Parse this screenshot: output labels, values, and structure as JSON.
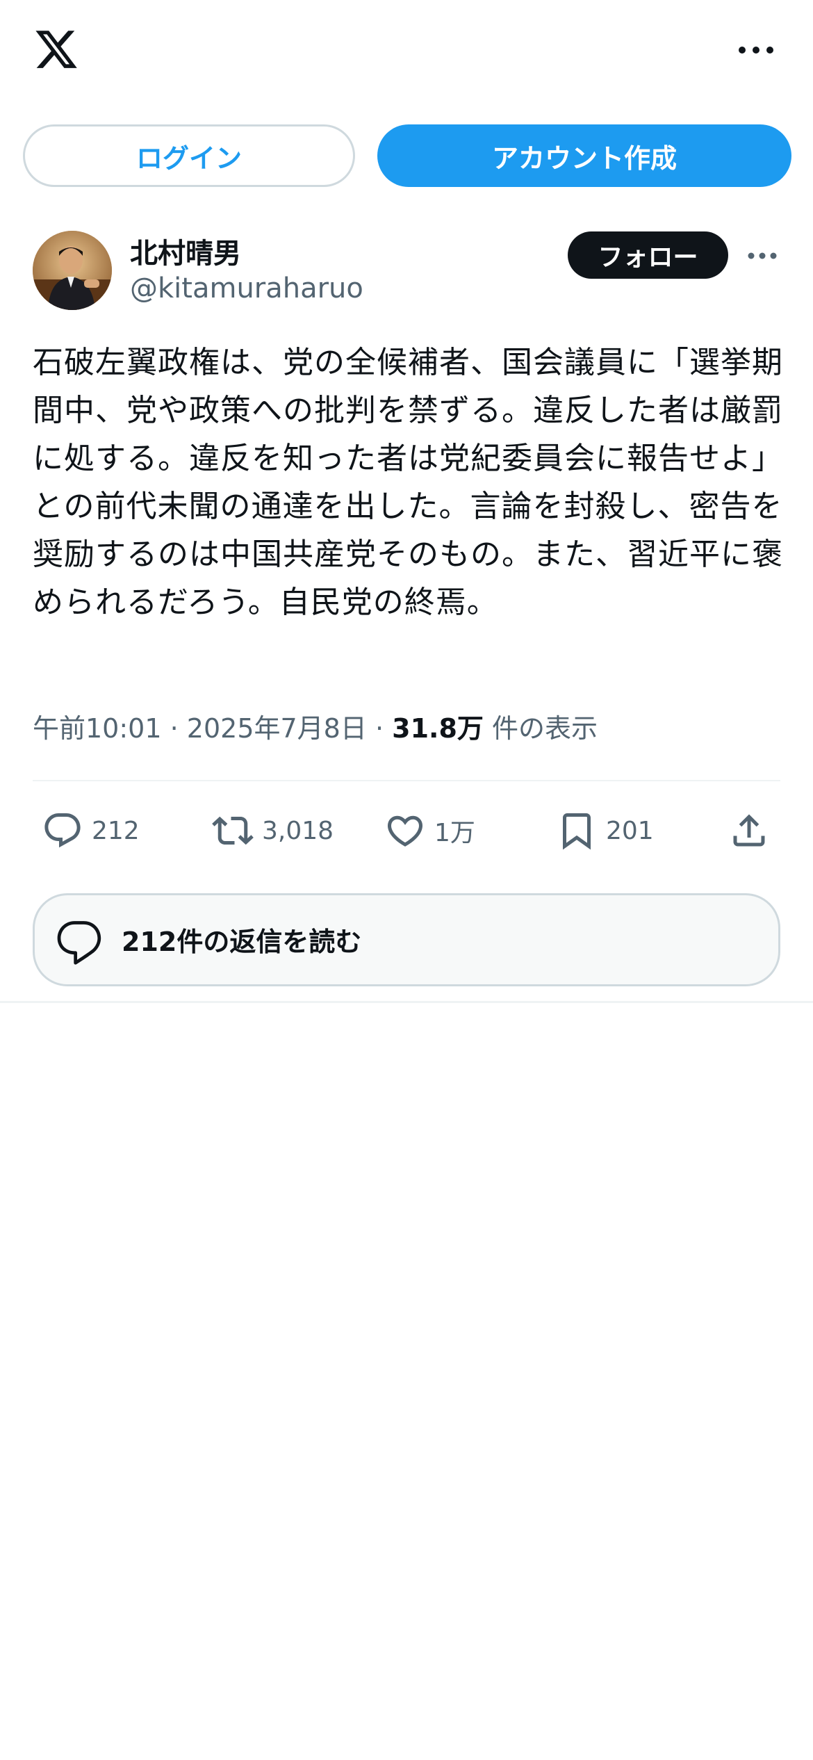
{
  "header": {
    "logo_icon": "x-logo-icon",
    "more_icon": "more-horizontal-icon"
  },
  "auth": {
    "login_label": "ログイン",
    "signup_label": "アカウント作成"
  },
  "author": {
    "name": "北村晴男",
    "handle": "@kitamuraharuo",
    "follow_label": "フォロー"
  },
  "tweet": {
    "text": "石破左翼政権は、党の全候補者、国会議員に「選挙期間中、党や政策への批判を禁ずる。違反した者は厳罰に処する。違反を知った者は党紀委員会に報告せよ」との前代未聞の通達を出した。言論を封殺し、密告を奨励するのは中国共産党そのもの。また、習近平に褒められるだろう。自民党の終焉。",
    "time": "午前10:01",
    "date": "2025年7月8日",
    "views_count": "31.8万",
    "views_label": "件の表示",
    "separator": "·"
  },
  "actions": {
    "replies": "212",
    "retweets": "3,018",
    "likes": "1万",
    "bookmarks": "201"
  },
  "read_replies": {
    "label": "212件の返信を読む"
  },
  "colors": {
    "accent": "#1d9bf0",
    "text_primary": "#0f1419",
    "text_secondary": "#536471",
    "border": "#cfd9de"
  }
}
